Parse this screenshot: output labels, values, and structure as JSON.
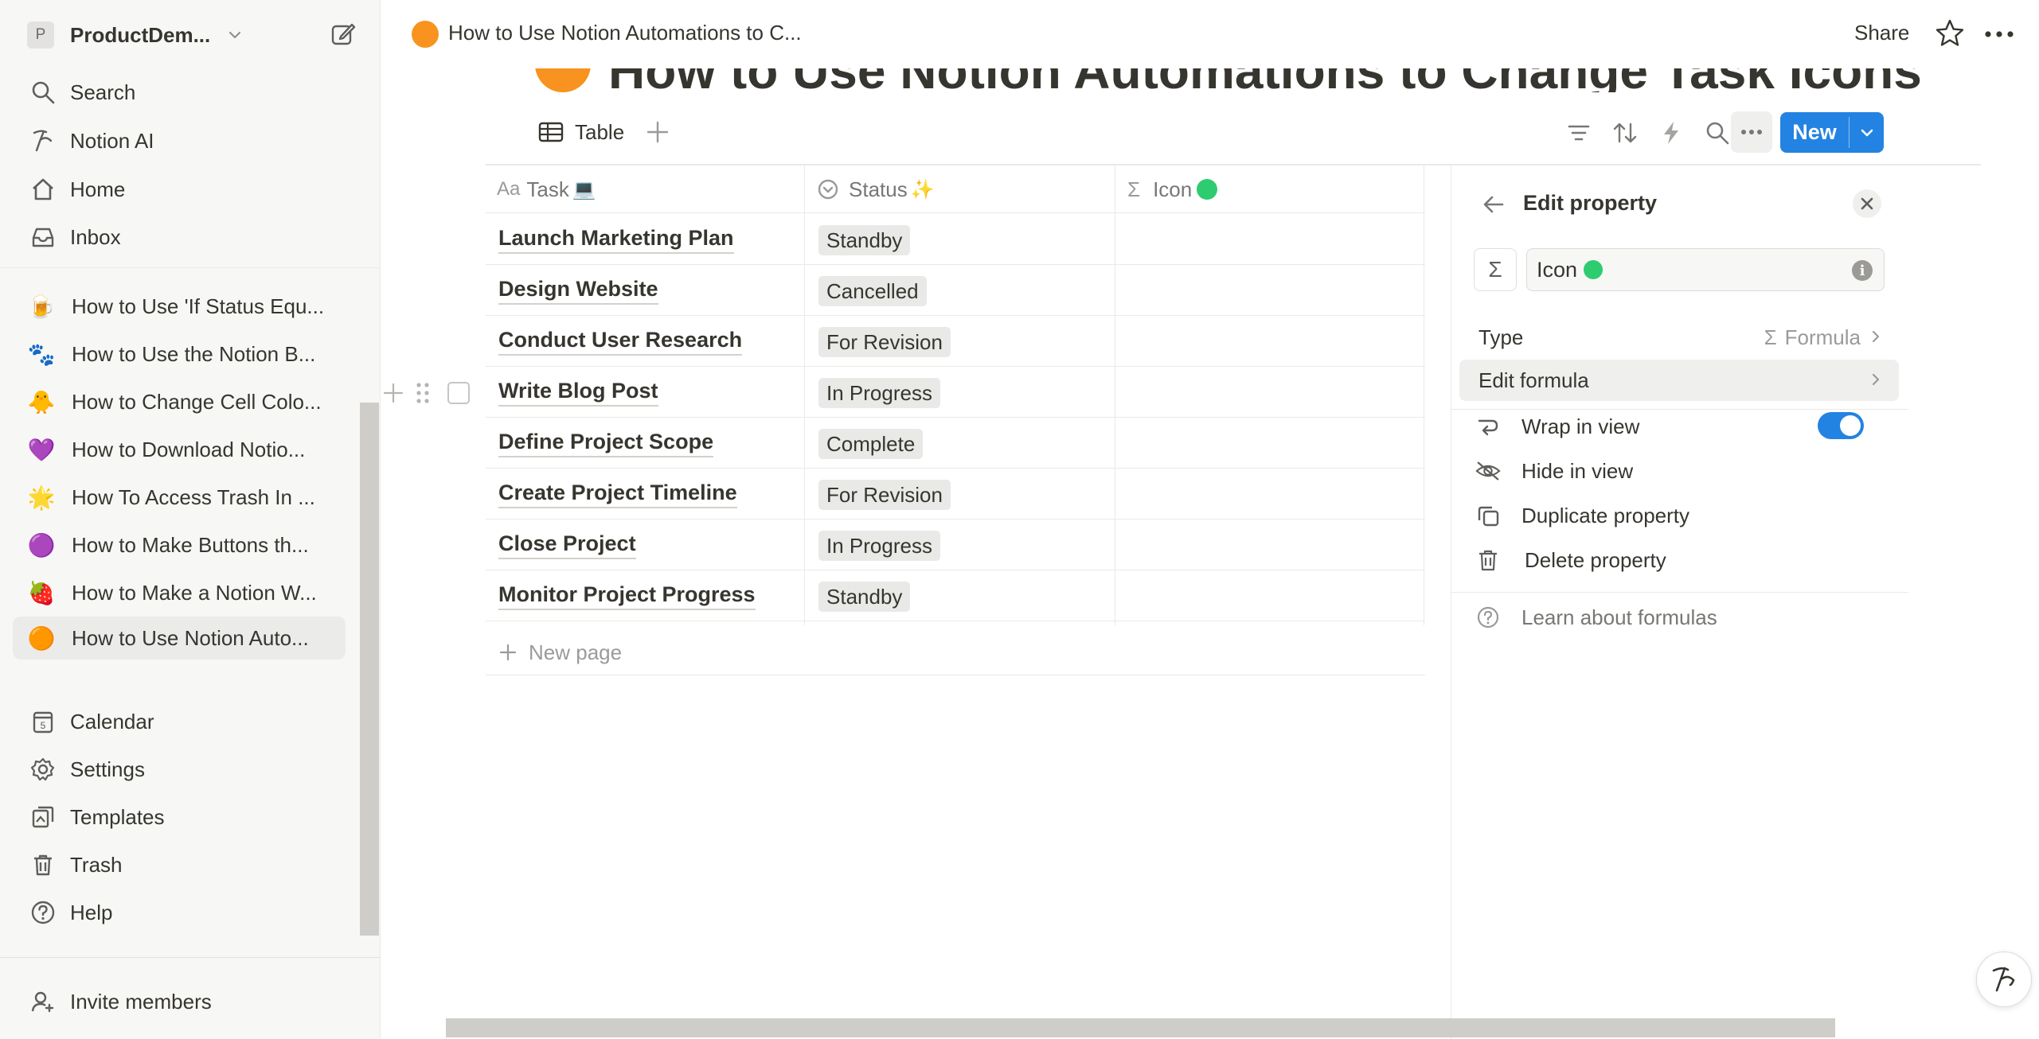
{
  "workspace": {
    "initial": "P",
    "name": "ProductDem..."
  },
  "sidebar": {
    "nav": [
      {
        "label": "Search",
        "icon": "search-icon"
      },
      {
        "label": "Notion AI",
        "icon": "notion-ai-icon"
      },
      {
        "label": "Home",
        "icon": "home-icon"
      },
      {
        "label": "Inbox",
        "icon": "inbox-icon"
      }
    ],
    "pages": [
      {
        "label": "How to Use 'If Status Equ...",
        "emoji": "🍺"
      },
      {
        "label": "How to Use the Notion B...",
        "emoji": "🐾"
      },
      {
        "label": "How to Change Cell Colo...",
        "emoji": "🐥"
      },
      {
        "label": "How to Download Notio...",
        "emoji": "💜"
      },
      {
        "label": "How To Access Trash In ...",
        "emoji": "🌟"
      },
      {
        "label": "How to Make Buttons th...",
        "emoji": "🟣"
      },
      {
        "label": "How to Make a Notion W...",
        "emoji": "🍓"
      },
      {
        "label": "How to Use Notion Auto...",
        "emoji": "🟠"
      }
    ],
    "bottom": [
      {
        "label": "Calendar",
        "icon": "calendar-icon",
        "day": "5"
      },
      {
        "label": "Settings",
        "icon": "gear-icon"
      },
      {
        "label": "Templates",
        "icon": "templates-icon"
      },
      {
        "label": "Trash",
        "icon": "trash-icon"
      },
      {
        "label": "Help",
        "icon": "help-icon"
      }
    ],
    "invite": "Invite members"
  },
  "topbar": {
    "breadcrumb": "How to Use Notion Automations to C...",
    "share": "Share"
  },
  "page": {
    "title": "How to Use Notion Automations to Change Task Icons",
    "view_tab": "Table",
    "new_button": "New"
  },
  "table": {
    "columns": [
      {
        "label": "Task",
        "prefix": "Aa",
        "emoji": "💻"
      },
      {
        "label": "Status",
        "emoji": "✨"
      },
      {
        "label": "Icon",
        "prefix": "Σ"
      }
    ],
    "rows": [
      {
        "task": "Launch Marketing Plan",
        "status": "Standby"
      },
      {
        "task": "Design Website",
        "status": "Cancelled"
      },
      {
        "task": "Conduct User Research",
        "status": "For Revision"
      },
      {
        "task": "Write Blog Post",
        "status": "In Progress"
      },
      {
        "task": "Define Project Scope",
        "status": "Complete"
      },
      {
        "task": "Create Project Timeline",
        "status": "For Revision"
      },
      {
        "task": "Close Project",
        "status": "In Progress"
      },
      {
        "task": "Monitor Project Progress",
        "status": "Standby"
      }
    ],
    "new_page": "New page"
  },
  "panel": {
    "title": "Edit property",
    "sigma": "Σ",
    "property_name": "Icon",
    "type_label": "Type",
    "type_value": "Formula",
    "edit_formula": "Edit formula",
    "wrap_in_view": "Wrap in view",
    "wrap_enabled": true,
    "hide_in_view": "Hide in view",
    "duplicate": "Duplicate property",
    "delete": "Delete property",
    "learn": "Learn about formulas"
  },
  "colors": {
    "accent": "#2383e2",
    "page_icon": "#f7931e",
    "green_dot": "#2ecc71"
  }
}
